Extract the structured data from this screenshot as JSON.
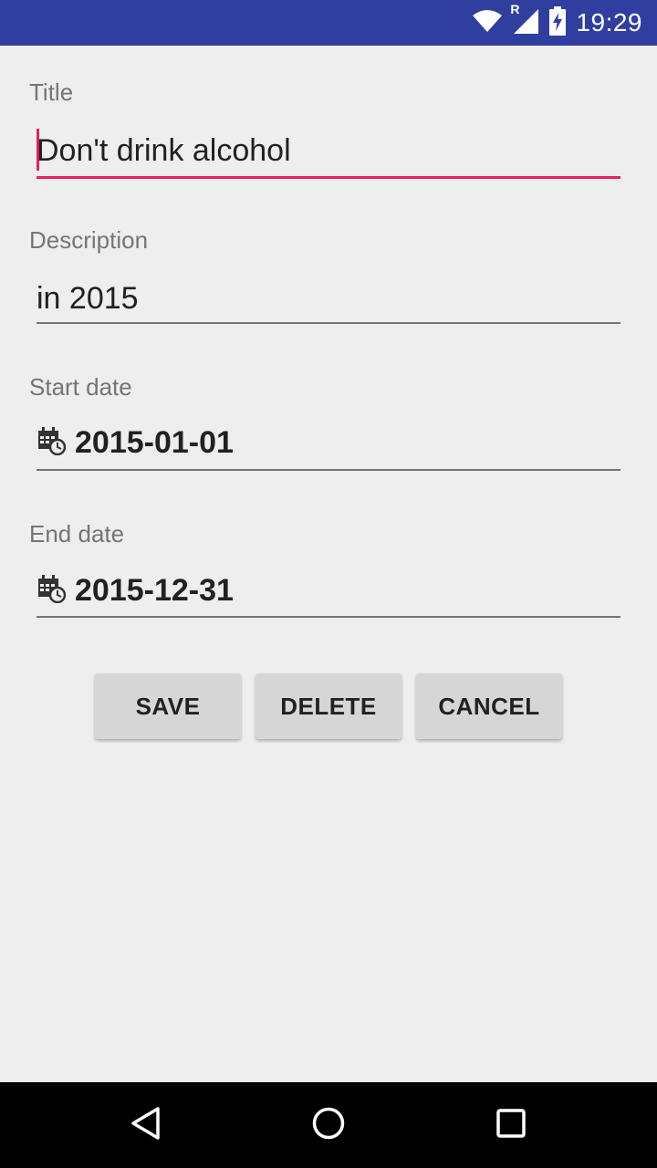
{
  "status_bar": {
    "time": "19:29",
    "background": "#303f9f",
    "icons": [
      "wifi-icon",
      "signal-roaming-icon",
      "battery-charging-icon"
    ],
    "roaming_indicator": "R"
  },
  "form": {
    "title": {
      "label": "Title",
      "value": "Don't drink alcohol"
    },
    "description": {
      "label": "Description",
      "value": "in 2015"
    },
    "start_date": {
      "label": "Start date",
      "value": "2015-01-01",
      "icon": "calendar-clock-icon"
    },
    "end_date": {
      "label": "End date",
      "value": "2015-12-31",
      "icon": "calendar-clock-icon"
    }
  },
  "buttons": {
    "save": "SAVE",
    "delete": "DELETE",
    "cancel": "CANCEL"
  },
  "nav_bar": {
    "icons": [
      "back-icon",
      "home-icon",
      "recents-icon"
    ]
  },
  "colors": {
    "accent": "#e91e63",
    "primary_dark": "#303f9f",
    "background": "#eeeeee",
    "button": "#d6d6d6"
  }
}
